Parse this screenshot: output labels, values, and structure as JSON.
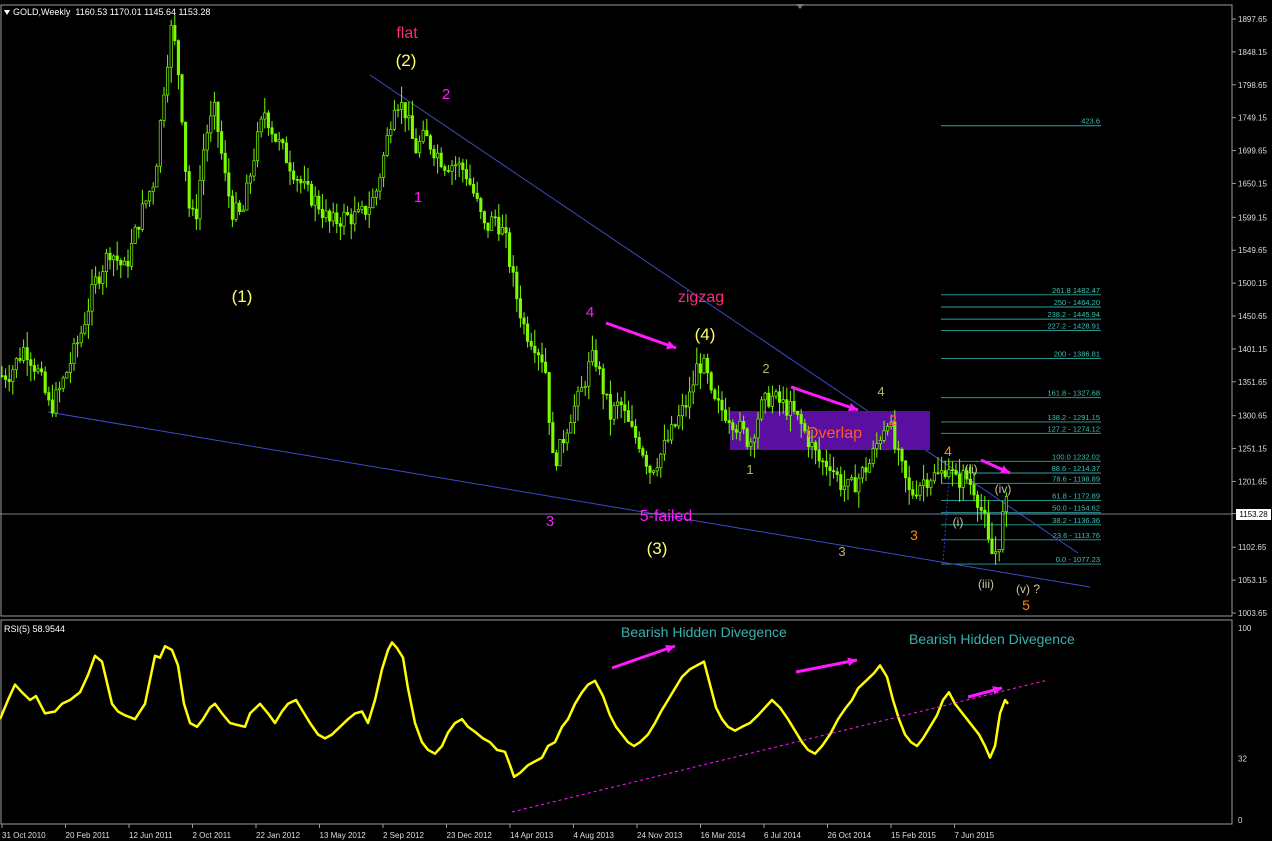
{
  "header": {
    "symbol": "GOLD,Weekly",
    "ohlc": "1160.53 1170.01 1145.64 1153.28"
  },
  "rsi_header": "RSI(5) 58.9544",
  "last_price_tag": "1153.28",
  "colors": {
    "background": "#000000",
    "candle": "#7cfc00",
    "rsi": "#ffff00",
    "trendline": "#3c4cc8",
    "fib": "#2aa9a0",
    "magenta": "#ff19ff",
    "orange": "#ff8c00",
    "yellow": "#ffff66",
    "overlap_box": "#5a0fa0",
    "overlap_text": "#ff5a1e"
  },
  "chart_data": [
    {
      "type": "candlestick",
      "title": "GOLD,Weekly",
      "ylim": [
        982,
        1918
      ],
      "y_ticks": [
        "1897.65",
        "1848.15",
        "1798.65",
        "1749.15",
        "1699.65",
        "1650.15",
        "1599.15",
        "1549.65",
        "1500.15",
        "1450.65",
        "1401.15",
        "1351.65",
        "1300.65",
        "1251.15",
        "1201.65",
        "1153.28",
        "1102.65",
        "1053.15",
        "1003.65"
      ],
      "x_ticks": [
        "31 Oct 2010",
        "20 Feb 2011",
        "12 Jun 2011",
        "2 Oct 2011",
        "22 Jan 2012",
        "13 May 2012",
        "2 Sep 2012",
        "23 Dec 2012",
        "14 Apr 2013",
        "4 Aug 2013",
        "24 Nov 2013",
        "16 Mar 2014",
        "6 Jul 2014",
        "26 Oct 2014",
        "15 Feb 2015",
        "7 Jun 2015"
      ],
      "close_path": [
        [
          0,
          1360
        ],
        [
          10,
          1365
        ],
        [
          25,
          1405
        ],
        [
          40,
          1360
        ],
        [
          50,
          1310
        ],
        [
          60,
          1340
        ],
        [
          80,
          1420
        ],
        [
          95,
          1500
        ],
        [
          110,
          1550
        ],
        [
          125,
          1520
        ],
        [
          140,
          1600
        ],
        [
          155,
          1660
        ],
        [
          165,
          1810
        ],
        [
          172,
          1890
        ],
        [
          180,
          1800
        ],
        [
          188,
          1620
        ],
        [
          195,
          1590
        ],
        [
          205,
          1720
        ],
        [
          215,
          1760
        ],
        [
          225,
          1660
        ],
        [
          232,
          1610
        ],
        [
          242,
          1600
        ],
        [
          255,
          1700
        ],
        [
          265,
          1760
        ],
        [
          275,
          1720
        ],
        [
          290,
          1680
        ],
        [
          305,
          1640
        ],
        [
          318,
          1620
        ],
        [
          330,
          1590
        ],
        [
          345,
          1600
        ],
        [
          360,
          1600
        ],
        [
          375,
          1630
        ],
        [
          385,
          1700
        ],
        [
          395,
          1780
        ],
        [
          405,
          1760
        ],
        [
          415,
          1700
        ],
        [
          425,
          1720
        ],
        [
          435,
          1700
        ],
        [
          445,
          1680
        ],
        [
          455,
          1680
        ],
        [
          465,
          1670
        ],
        [
          475,
          1630
        ],
        [
          485,
          1580
        ],
        [
          495,
          1600
        ],
        [
          505,
          1570
        ],
        [
          515,
          1490
        ],
        [
          525,
          1430
        ],
        [
          535,
          1410
        ],
        [
          545,
          1380
        ],
        [
          553,
          1230
        ],
        [
          560,
          1250
        ],
        [
          570,
          1300
        ],
        [
          580,
          1330
        ],
        [
          590,
          1380
        ],
        [
          595,
          1390
        ],
        [
          600,
          1360
        ],
        [
          610,
          1300
        ],
        [
          620,
          1320
        ],
        [
          630,
          1280
        ],
        [
          640,
          1260
        ],
        [
          650,
          1220
        ],
        [
          660,
          1240
        ],
        [
          670,
          1270
        ],
        [
          680,
          1300
        ],
        [
          690,
          1330
        ],
        [
          698,
          1380
        ],
        [
          706,
          1370
        ],
        [
          712,
          1320
        ],
        [
          722,
          1310
        ],
        [
          730,
          1300
        ],
        [
          740,
          1280
        ],
        [
          750,
          1260
        ],
        [
          760,
          1310
        ],
        [
          770,
          1330
        ],
        [
          780,
          1320
        ],
        [
          790,
          1310
        ],
        [
          800,
          1290
        ],
        [
          810,
          1260
        ],
        [
          820,
          1230
        ],
        [
          830,
          1230
        ],
        [
          840,
          1200
        ],
        [
          850,
          1190
        ],
        [
          860,
          1210
        ],
        [
          870,
          1230
        ],
        [
          880,
          1270
        ],
        [
          888,
          1300
        ],
        [
          895,
          1250
        ],
        [
          902,
          1220
        ],
        [
          910,
          1180
        ],
        [
          920,
          1200
        ],
        [
          930,
          1210
        ],
        [
          940,
          1210
        ],
        [
          948,
          1230
        ],
        [
          955,
          1200
        ],
        [
          965,
          1210
        ],
        [
          975,
          1190
        ],
        [
          985,
          1140
        ],
        [
          990,
          1090
        ],
        [
          998,
          1100
        ],
        [
          1005,
          1170
        ],
        [
          1008,
          1160
        ]
      ]
    },
    {
      "type": "line",
      "title": "RSI(5) 58.9544",
      "ylim": [
        0,
        100
      ],
      "y_ticks": [
        "100",
        "32",
        "0"
      ],
      "values": [
        [
          0,
          52
        ],
        [
          8,
          62
        ],
        [
          15,
          70
        ],
        [
          22,
          66
        ],
        [
          30,
          62
        ],
        [
          36,
          64
        ],
        [
          45,
          55
        ],
        [
          55,
          56
        ],
        [
          62,
          60
        ],
        [
          70,
          62
        ],
        [
          80,
          66
        ],
        [
          88,
          75
        ],
        [
          95,
          85
        ],
        [
          102,
          82
        ],
        [
          112,
          60
        ],
        [
          118,
          56
        ],
        [
          125,
          54
        ],
        [
          135,
          52
        ],
        [
          145,
          60
        ],
        [
          155,
          85
        ],
        [
          160,
          84
        ],
        [
          165,
          90
        ],
        [
          172,
          88
        ],
        [
          178,
          80
        ],
        [
          184,
          60
        ],
        [
          190,
          50
        ],
        [
          197,
          48
        ],
        [
          203,
          52
        ],
        [
          210,
          58
        ],
        [
          215,
          60
        ],
        [
          222,
          55
        ],
        [
          230,
          50
        ],
        [
          237,
          49
        ],
        [
          245,
          48
        ],
        [
          250,
          55
        ],
        [
          260,
          60
        ],
        [
          268,
          55
        ],
        [
          275,
          50
        ],
        [
          282,
          56
        ],
        [
          288,
          60
        ],
        [
          296,
          62
        ],
        [
          303,
          56
        ],
        [
          310,
          50
        ],
        [
          318,
          44
        ],
        [
          325,
          42
        ],
        [
          332,
          44
        ],
        [
          340,
          48
        ],
        [
          348,
          52
        ],
        [
          355,
          55
        ],
        [
          362,
          56
        ],
        [
          368,
          50
        ],
        [
          375,
          62
        ],
        [
          382,
          78
        ],
        [
          388,
          88
        ],
        [
          392,
          92
        ],
        [
          397,
          89
        ],
        [
          403,
          84
        ],
        [
          408,
          68
        ],
        [
          415,
          50
        ],
        [
          422,
          40
        ],
        [
          428,
          36
        ],
        [
          435,
          34
        ],
        [
          442,
          38
        ],
        [
          448,
          45
        ],
        [
          455,
          50
        ],
        [
          462,
          52
        ],
        [
          468,
          48
        ],
        [
          476,
          45
        ],
        [
          483,
          42
        ],
        [
          490,
          40
        ],
        [
          497,
          36
        ],
        [
          505,
          35
        ],
        [
          510,
          28
        ],
        [
          514,
          22
        ],
        [
          520,
          24
        ],
        [
          528,
          28
        ],
        [
          535,
          30
        ],
        [
          542,
          32
        ],
        [
          548,
          38
        ],
        [
          555,
          40
        ],
        [
          562,
          48
        ],
        [
          568,
          52
        ],
        [
          575,
          60
        ],
        [
          582,
          66
        ],
        [
          588,
          70
        ],
        [
          595,
          72
        ],
        [
          603,
          64
        ],
        [
          610,
          54
        ],
        [
          616,
          48
        ],
        [
          622,
          44
        ],
        [
          628,
          40
        ],
        [
          634,
          38
        ],
        [
          640,
          40
        ],
        [
          648,
          44
        ],
        [
          655,
          50
        ],
        [
          661,
          56
        ],
        [
          668,
          62
        ],
        [
          675,
          68
        ],
        [
          682,
          74
        ],
        [
          690,
          78
        ],
        [
          697,
          80
        ],
        [
          704,
          82
        ],
        [
          710,
          70
        ],
        [
          716,
          58
        ],
        [
          722,
          52
        ],
        [
          728,
          48
        ],
        [
          735,
          46
        ],
        [
          742,
          48
        ],
        [
          750,
          50
        ],
        [
          758,
          54
        ],
        [
          765,
          58
        ],
        [
          772,
          62
        ],
        [
          780,
          58
        ],
        [
          788,
          52
        ],
        [
          795,
          46
        ],
        [
          802,
          40
        ],
        [
          808,
          36
        ],
        [
          815,
          34
        ],
        [
          822,
          38
        ],
        [
          830,
          44
        ],
        [
          838,
          52
        ],
        [
          846,
          58
        ],
        [
          852,
          62
        ],
        [
          858,
          68
        ],
        [
          866,
          72
        ],
        [
          874,
          76
        ],
        [
          880,
          80
        ],
        [
          887,
          74
        ],
        [
          893,
          62
        ],
        [
          899,
          52
        ],
        [
          905,
          44
        ],
        [
          911,
          40
        ],
        [
          917,
          38
        ],
        [
          923,
          42
        ],
        [
          930,
          48
        ],
        [
          937,
          54
        ],
        [
          943,
          62
        ],
        [
          949,
          66
        ],
        [
          955,
          60
        ],
        [
          961,
          56
        ],
        [
          967,
          52
        ],
        [
          973,
          48
        ],
        [
          979,
          44
        ],
        [
          985,
          38
        ],
        [
          990,
          32
        ],
        [
          995,
          38
        ],
        [
          1000,
          55
        ],
        [
          1005,
          62
        ],
        [
          1008,
          60
        ]
      ]
    }
  ],
  "fib_levels": [
    {
      "label": "423.6",
      "price": 1737
    },
    {
      "label": "261.8 1482.47",
      "price": 1482.47
    },
    {
      "label": "250 - 1464.20",
      "price": 1464.2
    },
    {
      "label": "238.2 - 1445.94",
      "price": 1445.94
    },
    {
      "label": "227.2 - 1428.91",
      "price": 1428.91
    },
    {
      "label": "200 - 1386.81",
      "price": 1386.81
    },
    {
      "label": "161.8 - 1327.68",
      "price": 1327.68
    },
    {
      "label": "138.2 - 1291.15",
      "price": 1291.15
    },
    {
      "label": "127.2 - 1274.12",
      "price": 1274.12
    },
    {
      "label": "100.0 1232.02",
      "price": 1232.02
    },
    {
      "label": "88.6 - 1214.37",
      "price": 1214.37
    },
    {
      "label": "78.6 - 1198.89",
      "price": 1198.89
    },
    {
      "label": "61.8 - 1172.89",
      "price": 1172.89
    },
    {
      "label": "50.0 - 1154.62",
      "price": 1154.62
    },
    {
      "label": "38.2 - 1136.36",
      "price": 1136.36
    },
    {
      "label": "23.6 - 1113.76",
      "price": 1113.76
    },
    {
      "label": "0.0 - 1077.23",
      "price": 1077.23
    }
  ],
  "annotations": {
    "flat": "flat",
    "wave_2_major": "(2)",
    "wave_1_major": "(1)",
    "wave_3_major": "(3)",
    "wave_4_major": "(4)",
    "zigzag": "zigzag",
    "five_failed": "5-failed",
    "overlap": "Overlap",
    "m1": "1",
    "m2": "2",
    "m3": "3",
    "m4": "4",
    "o2": "2",
    "o3": "3",
    "o4": "4",
    "o5": "5",
    "g1": "1",
    "g2": "2",
    "g3": "3",
    "g4": "4",
    "wi": "(i)",
    "wii": "(ii)",
    "wiii": "(iii)",
    "wiv": "(iv)",
    "wv": "(v) ?",
    "bearish1": "Bearish Hidden Divegence",
    "bearish2": "Bearish Hidden Divegence"
  }
}
